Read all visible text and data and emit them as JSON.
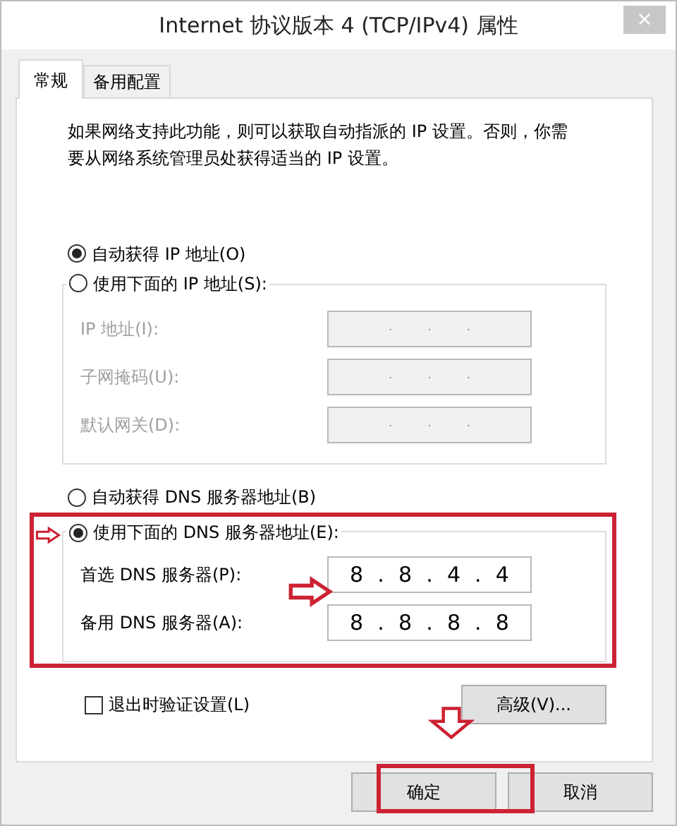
{
  "window": {
    "title": "Internet 协议版本 4 (TCP/IPv4) 属性",
    "close_glyph": "×"
  },
  "tabs": [
    {
      "label": "常规",
      "selected": true
    },
    {
      "label": "备用配置",
      "selected": false
    }
  ],
  "description": "如果网络支持此功能，则可以获取自动指派的 IP 设置。否则，你需要从网络系统管理员处获得适当的 IP 设置。",
  "ip_options": [
    {
      "label": "自动获得 IP 地址(O)",
      "selected": true
    },
    {
      "label": "使用下面的 IP 地址(S):",
      "selected": false
    }
  ],
  "ip_fields": [
    {
      "label": "IP 地址(I):",
      "value": ". . .",
      "disabled": true
    },
    {
      "label": "子网掩码(U):",
      "value": ". . .",
      "disabled": true
    },
    {
      "label": "默认网关(D):",
      "value": ". . .",
      "disabled": true
    }
  ],
  "dns_options": [
    {
      "label": "自动获得 DNS 服务器地址(B)",
      "selected": false
    },
    {
      "label": "使用下面的 DNS 服务器地址(E):",
      "selected": true
    }
  ],
  "dns_fields": [
    {
      "label": "首选 DNS 服务器(P):",
      "value": "8 . 8 . 4 . 4",
      "disabled": false
    },
    {
      "label": "备用 DNS 服务器(A):",
      "value": "8 . 8 . 8 . 8",
      "disabled": false
    }
  ],
  "validate_checkbox": {
    "label": "退出时验证设置(L)",
    "checked": false
  },
  "advanced_button": "高级(V)...",
  "buttons": [
    "确定",
    "取消"
  ]
}
